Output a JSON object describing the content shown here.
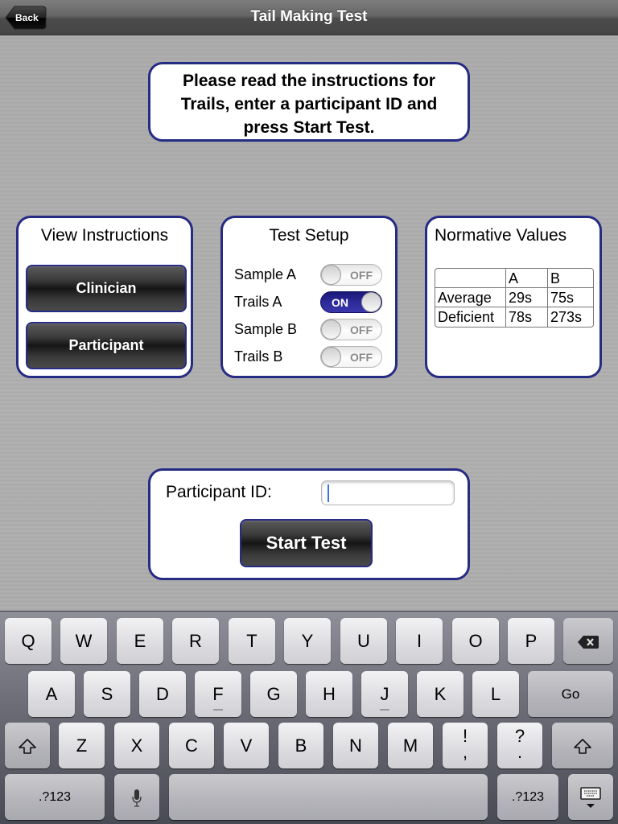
{
  "navbar": {
    "title": "Tail Making Test",
    "back_label": "Back"
  },
  "instructions": {
    "text": "Please read the instructions for Trails, enter a participant ID and press Start Test."
  },
  "view_instructions": {
    "title": "View Instructions",
    "buttons": [
      {
        "label": "Clinician"
      },
      {
        "label": "Participant"
      }
    ]
  },
  "test_setup": {
    "title": "Test Setup",
    "items": [
      {
        "label": "Sample A",
        "state": "OFF",
        "on": false
      },
      {
        "label": "Trails A",
        "state": "ON",
        "on": true
      },
      {
        "label": "Sample B",
        "state": "OFF",
        "on": false
      },
      {
        "label": "Trails B",
        "state": "OFF",
        "on": false
      }
    ]
  },
  "normative_values": {
    "title": "Normative Values",
    "columns": [
      "",
      "A",
      "B"
    ],
    "rows": [
      [
        "Average",
        "29s",
        "75s"
      ],
      [
        "Deficient",
        "78s",
        "273s"
      ]
    ]
  },
  "participant": {
    "label": "Participant ID:",
    "value": "",
    "start_label": "Start Test"
  },
  "keyboard": {
    "row1": [
      "Q",
      "W",
      "E",
      "R",
      "T",
      "Y",
      "U",
      "I",
      "O",
      "P"
    ],
    "row2": [
      "A",
      "S",
      "D",
      "F",
      "G",
      "H",
      "J",
      "K",
      "L"
    ],
    "row3": [
      "Z",
      "X",
      "C",
      "V",
      "B",
      "N",
      "M"
    ],
    "go_label": "Go",
    "numbers_label": ".?123",
    "punct1_top": "!",
    "punct1_bottom": ",",
    "punct2_top": "?",
    "punct2_bottom": ".",
    "icons": {
      "backspace": "backspace-icon",
      "shift": "shift-icon",
      "mic": "microphone-icon",
      "hide": "hide-keyboard-icon"
    }
  },
  "colors": {
    "panel_border": "#262b84",
    "toggle_on": "#2d2a9a",
    "caret": "#3a6ff0"
  }
}
